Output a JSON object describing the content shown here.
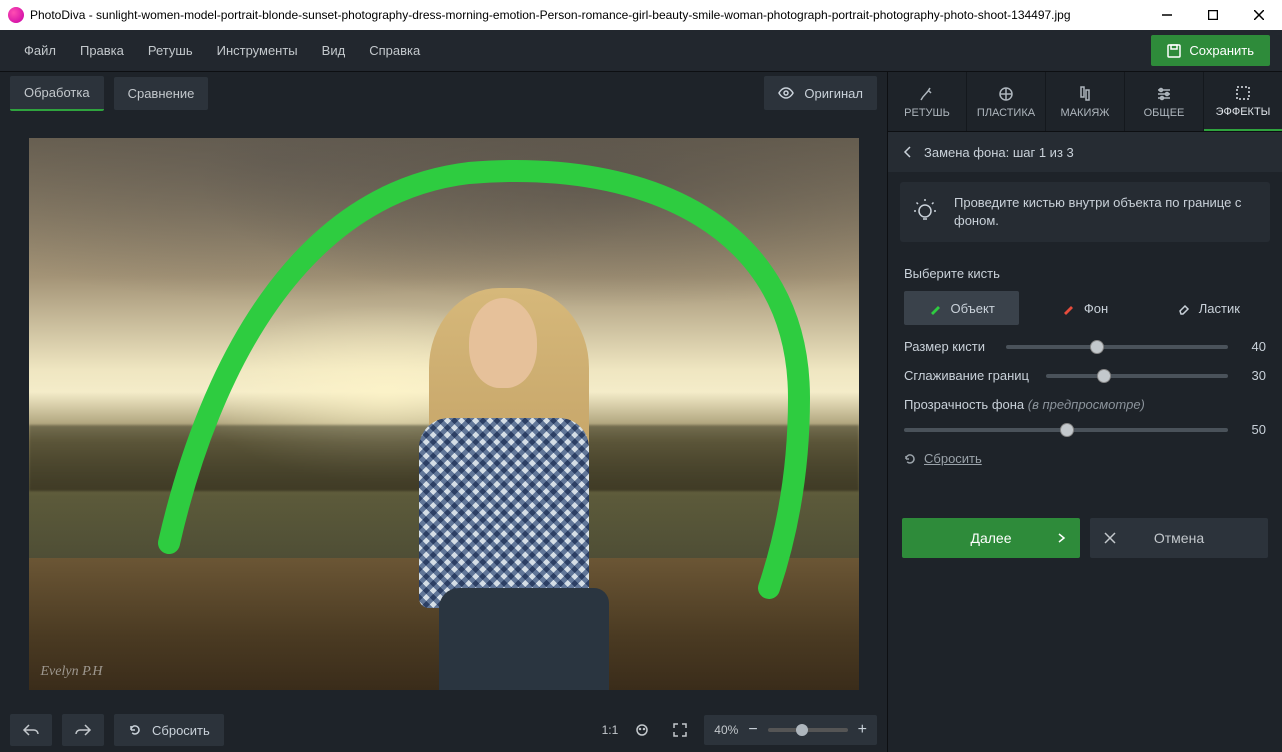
{
  "window": {
    "app_name": "PhotoDiva",
    "file_name": "sunlight-women-model-portrait-blonde-sunset-photography-dress-morning-emotion-Person-romance-girl-beauty-smile-woman-photograph-portrait-photography-photo-shoot-134497.jpg"
  },
  "menubar": {
    "items": [
      "Файл",
      "Правка",
      "Ретушь",
      "Инструменты",
      "Вид",
      "Справка"
    ],
    "save": "Сохранить"
  },
  "canvas": {
    "tabs": {
      "edit": "Обработка",
      "compare": "Сравнение"
    },
    "original": "Оригинал",
    "watermark": "Evelyn P.H"
  },
  "bottom": {
    "reset": "Сбросить",
    "ratio": "1:1",
    "zoom": "40%"
  },
  "right": {
    "tabs": [
      "РЕТУШЬ",
      "ПЛАСТИКА",
      "МАКИЯЖ",
      "ОБЩЕЕ",
      "ЭФФЕКТЫ"
    ],
    "step_title": "Замена фона: шаг 1 из 3",
    "hint": "Проведите кистью внутри объекта по границе с фоном.",
    "brush_section": "Выберите кисть",
    "brushes": {
      "object": "Объект",
      "background": "Фон",
      "eraser": "Ластик"
    },
    "sliders": {
      "size_label": "Размер кисти",
      "size_value": "40",
      "smooth_label": "Сглаживание границ",
      "smooth_value": "30",
      "opacity_label": "Прозрачность фона",
      "opacity_hint": "(в предпросмотре)",
      "opacity_value": "50"
    },
    "reset_link": "Сбросить",
    "next": "Далее",
    "cancel": "Отмена"
  }
}
